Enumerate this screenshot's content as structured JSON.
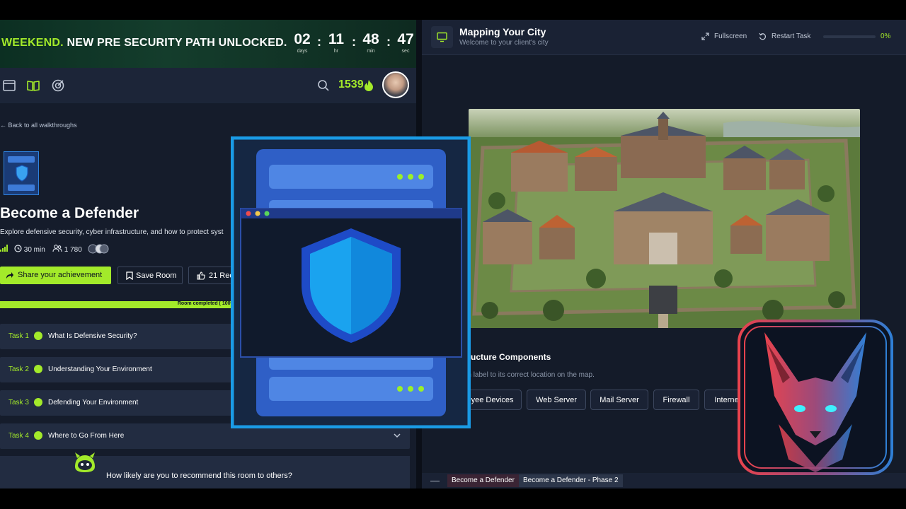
{
  "promo": {
    "highlight": "WEEKEND.",
    "text": " NEW PRE SECURITY PATH UNLOCKED.",
    "countdown": [
      {
        "value": "02",
        "unit": "days"
      },
      {
        "value": "11",
        "unit": "hr"
      },
      {
        "value": "48",
        "unit": "min"
      },
      {
        "value": "47",
        "unit": "sec"
      }
    ],
    "separator": ":"
  },
  "navbar": {
    "streak": "1539"
  },
  "room": {
    "back_link": "Back to all walkthroughs",
    "title": "Become a Defender",
    "description": "Explore defensive security, cyber infrastructure, and how to protect syst",
    "duration": "30 min",
    "users": "1 780",
    "share_label": "Share your achievement",
    "save_label": "Save Room",
    "recommend_label": "21 Reco",
    "progress_label": "Room completed ( 100% )",
    "progress_value": 100
  },
  "tasks": [
    {
      "number": "Task 1",
      "title": "What Is Defensive Security?"
    },
    {
      "number": "Task 2",
      "title": "Understanding Your Environment"
    },
    {
      "number": "Task 3",
      "title": "Defending Your Environment"
    },
    {
      "number": "Task 4",
      "title": "Where to Go From Here"
    }
  ],
  "recommend_question": "How likely are you to recommend this room to others?",
  "task_panel": {
    "title": "Mapping Your City",
    "subtitle": "Welcome to your client's city",
    "fullscreen_label": "Fullscreen",
    "restart_label": "Restart Task",
    "progress_pct": "0%",
    "progress_value": 0,
    "section_title": "nfrastructure Components",
    "instructions": "rag each label to its correct location on the map.",
    "labels": [
      "Employee Devices",
      "Web Server",
      "Mail Server",
      "Firewall",
      "Internet"
    ]
  },
  "bottom_tabs": [
    "Become a Defender",
    "Become a Defender - Phase 2"
  ],
  "colors": {
    "accent": "#a3ea2a",
    "panel": "#222c41",
    "background": "#151c2b",
    "overlay_border": "#1a9be6"
  }
}
